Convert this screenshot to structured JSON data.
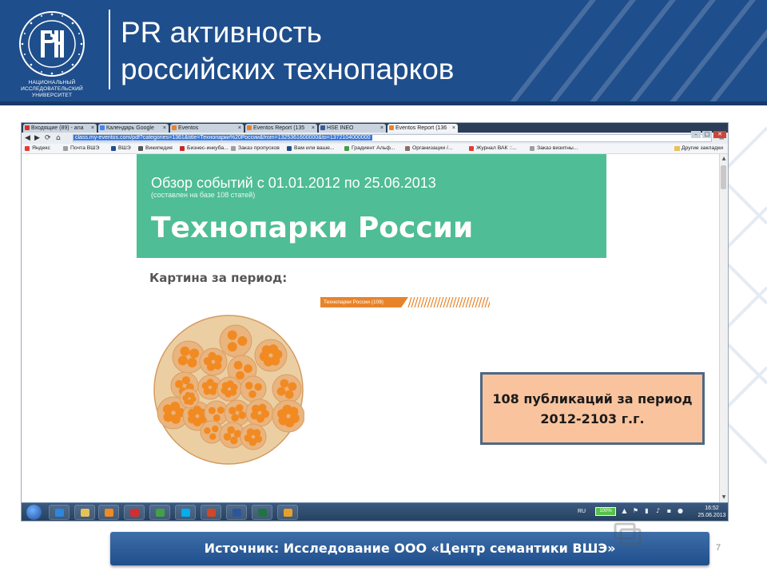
{
  "slide": {
    "title_line1": "PR активность",
    "title_line2": "российских технопарков",
    "university_name_line1": "НАЦИОНАЛЬНЫЙ ИССЛЕДОВАТЕЛЬСКИЙ",
    "university_name_line2": "УНИВЕРСИТЕТ",
    "callout": "108 публикаций за период 2012-2103 г.г.",
    "footer": "Источник: Исследование ООО «Центр семантики ВШЭ»",
    "page_number": "7"
  },
  "colors": {
    "brand_blue": "#1f4e8c",
    "report_green": "#4fbd96",
    "accent_orange": "#e8832a",
    "callout_fill": "#f9c39d"
  },
  "browser": {
    "tabs": [
      {
        "label": "Входящие (89) - ana",
        "icon": "gmail-icon",
        "color": "#d93025"
      },
      {
        "label": "Календарь Google",
        "icon": "calendar-icon",
        "color": "#4285f4"
      },
      {
        "label": "Eventos",
        "icon": "eventos-icon",
        "color": "#e8832a"
      },
      {
        "label": "Eventos Report (135",
        "icon": "eventos-icon",
        "color": "#e8832a"
      },
      {
        "label": "HSE INEO",
        "icon": "facebook-icon",
        "color": "#3b5998"
      },
      {
        "label": "Eventos Report (136",
        "icon": "eventos-icon",
        "color": "#e8832a"
      }
    ],
    "url": "class.my-eventos.com/pdf?categories=1361&title=Технопарки%20России&from=1325361600000&to=1372104000000",
    "bookmarks": [
      {
        "label": "Яндекс",
        "icon": "yandex-icon",
        "color": "#e53935"
      },
      {
        "label": "Почта ВШЭ",
        "icon": "document-icon",
        "color": "#9e9e9e"
      },
      {
        "label": "ВШЭ",
        "icon": "hse-icon",
        "color": "#1f4e8c"
      },
      {
        "label": "Википедия",
        "icon": "wikipedia-icon",
        "color": "#555555"
      },
      {
        "label": "Бизнес-инкуба...",
        "icon": "bookmark-icon",
        "color": "#c62828"
      },
      {
        "label": "Заказ пропусков",
        "icon": "document-icon",
        "color": "#9e9e9e"
      },
      {
        "label": "Вам или ваше...",
        "icon": "bookmark-icon",
        "color": "#1f4e8c"
      },
      {
        "label": "Градиент Альф...",
        "icon": "bookmark-icon",
        "color": "#43a047"
      },
      {
        "label": "Организации /...",
        "icon": "globe-icon",
        "color": "#8d6e63"
      },
      {
        "label": "Журнал ВАК ::...",
        "icon": "bookmark-icon",
        "color": "#e53935"
      },
      {
        "label": "Заказ визитны...",
        "icon": "document-icon",
        "color": "#9e9e9e"
      }
    ],
    "other_bookmarks": "Другие закладки"
  },
  "report": {
    "overview": "Обзор событий с 01.01.2012 по 25.06.2013",
    "basis": "(составлен на базе 108 статей)",
    "title": "Технопарки России",
    "period_heading": "Картина за период:",
    "legend_label": "Технопарки России (108)"
  },
  "taskbar": {
    "apps": [
      {
        "name": "ie-icon",
        "color": "#2e86de"
      },
      {
        "name": "explorer-icon",
        "color": "#e6c15a"
      },
      {
        "name": "media-player-icon",
        "color": "#f08a24"
      },
      {
        "name": "hse-app-icon",
        "color": "#d32f2f"
      },
      {
        "name": "chrome-icon",
        "color": "#43a047"
      },
      {
        "name": "skype-icon",
        "color": "#00aff0"
      },
      {
        "name": "powerpoint-icon",
        "color": "#d24726"
      },
      {
        "name": "word-icon",
        "color": "#2b579a"
      },
      {
        "name": "excel-icon",
        "color": "#217346"
      },
      {
        "name": "outlook-icon",
        "color": "#e8a02a"
      }
    ],
    "language": "RU",
    "battery": "100%",
    "time": "16:52",
    "date": "25.06.2013"
  }
}
